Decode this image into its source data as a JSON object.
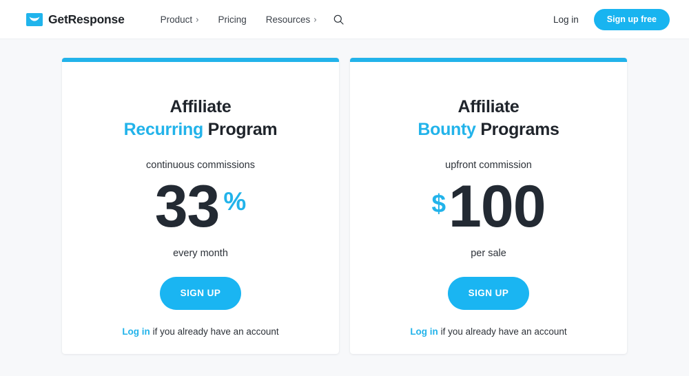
{
  "header": {
    "brand": {
      "name": "GetResponse",
      "logo_icon": "envelope-icon",
      "mark_color": "#20b4ec"
    },
    "nav": [
      {
        "label": "Product",
        "has_chevron": true,
        "chevron": "›"
      },
      {
        "label": "Pricing",
        "has_chevron": false,
        "chevron": ""
      },
      {
        "label": "Resources",
        "has_chevron": true,
        "chevron": "›"
      }
    ],
    "search_icon": "search-icon",
    "login_label": "Log in",
    "signup_label": "Sign up free",
    "accent_color": "#18b4f0"
  },
  "cards": [
    {
      "title_line1": "Affiliate",
      "title_accent": "Recurring",
      "title_rest": "Program",
      "subtitle": "continuous commissions",
      "prefix": "",
      "number": "33",
      "suffix": "%",
      "caption": "every month",
      "cta_label": "SIGN UP",
      "foot_link": "Log in",
      "foot_text": " if you already have an account"
    },
    {
      "title_line1": "Affiliate",
      "title_accent": "Bounty",
      "title_rest": "Programs",
      "subtitle": "upfront commission",
      "prefix": "$",
      "number": "100",
      "suffix": "",
      "caption": "per sale",
      "cta_label": "SIGN UP",
      "foot_link": "Log in",
      "foot_text": " if you already have an account"
    }
  ],
  "theme": {
    "accent": "#22b3ea",
    "cta": "#1ab5f2",
    "text": "#232a33",
    "page_bg": "#f7f8fa"
  }
}
